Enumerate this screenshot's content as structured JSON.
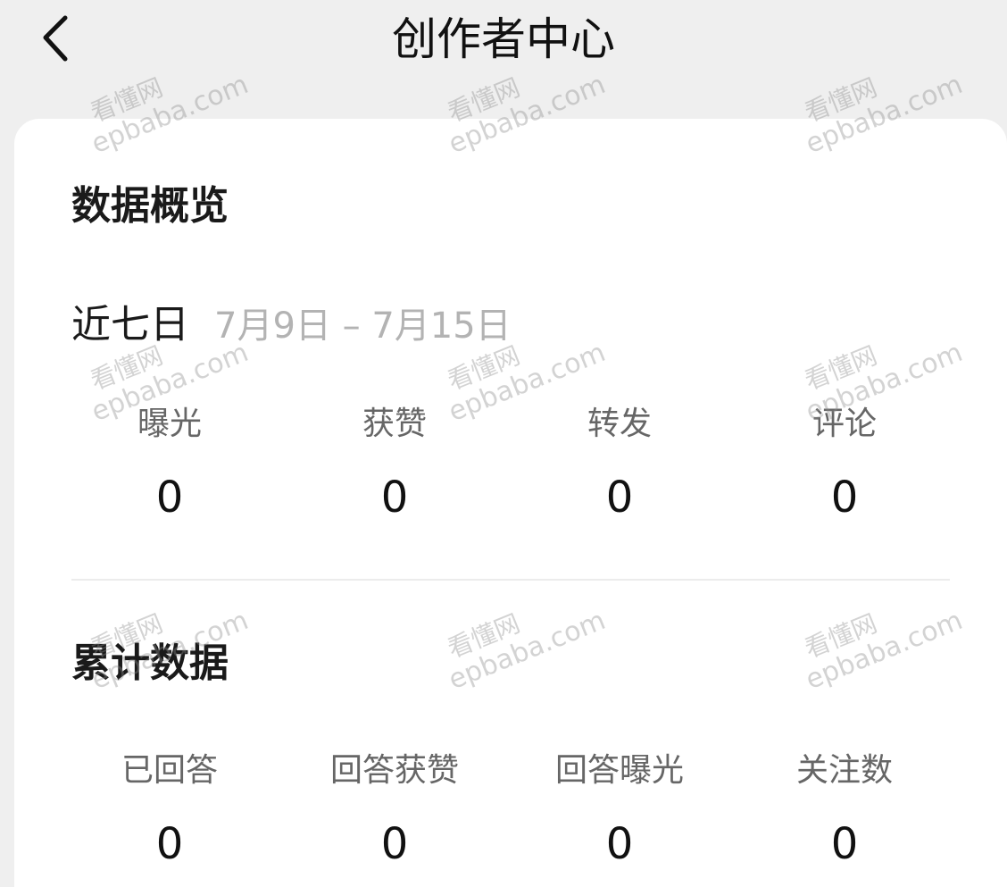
{
  "nav": {
    "title": "创作者中心",
    "back_icon": "chevron-left-icon"
  },
  "overview": {
    "title": "数据概览",
    "range_label": "近七日",
    "range_dates": "7月9日 – 7月15日",
    "stats": [
      {
        "label": "曝光",
        "value": "0"
      },
      {
        "label": "获赞",
        "value": "0"
      },
      {
        "label": "转发",
        "value": "0"
      },
      {
        "label": "评论",
        "value": "0"
      }
    ]
  },
  "cumulative": {
    "title": "累计数据",
    "stats": [
      {
        "label": "已回答",
        "value": "0"
      },
      {
        "label": "回答获赞",
        "value": "0"
      },
      {
        "label": "回答曝光",
        "value": "0"
      },
      {
        "label": "关注数",
        "value": "0"
      }
    ]
  },
  "watermark": {
    "cn": "看懂网",
    "en": "epbaba.com"
  }
}
